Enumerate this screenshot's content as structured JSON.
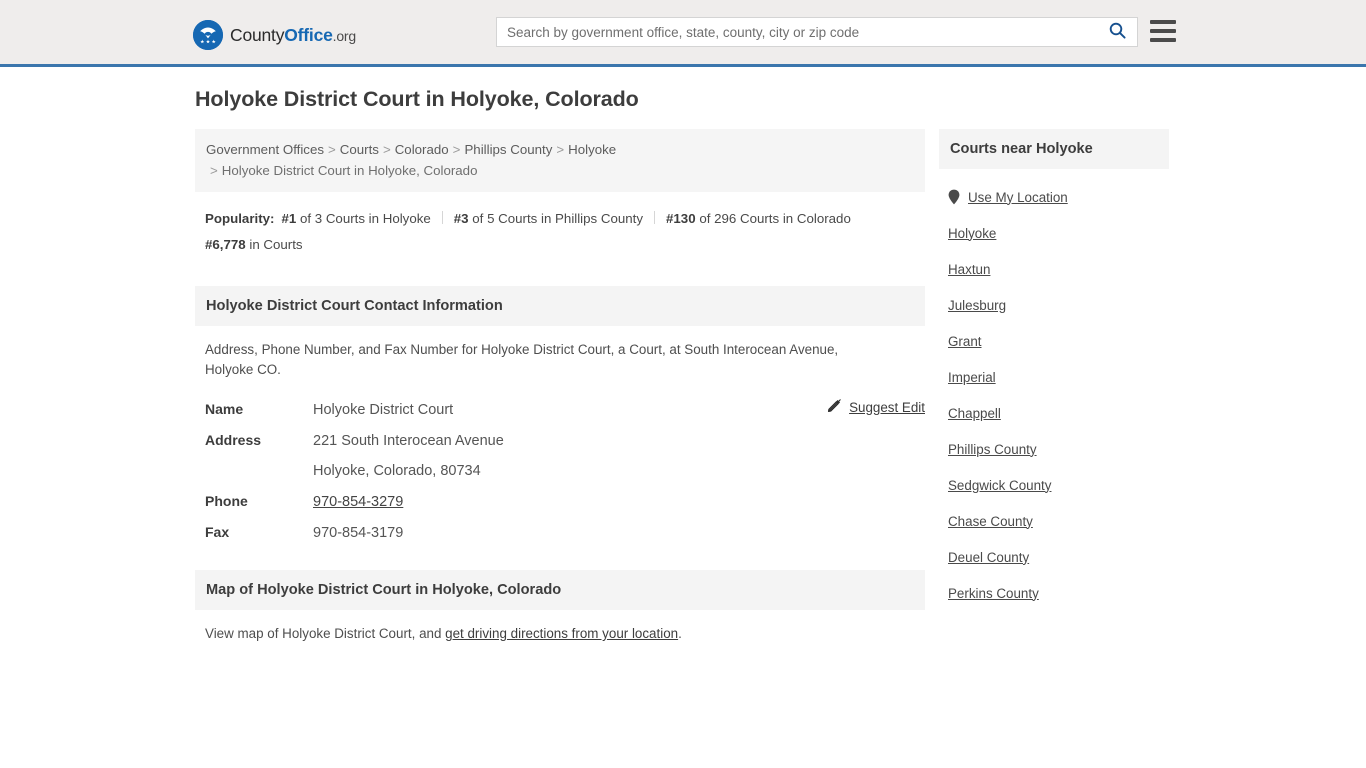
{
  "header": {
    "logo": {
      "part1": "County",
      "part2": "Office",
      "tld": ".org",
      "icon": "eagle-seal-icon"
    },
    "search": {
      "placeholder": "Search by government office, state, county, city or zip code",
      "value": "",
      "button_icon": "search-icon"
    },
    "menu_icon": "hamburger-menu-icon",
    "accent_color": "#3b76ad",
    "background_color": "#efedec"
  },
  "page_title": "Holyoke District Court in Holyoke, Colorado",
  "breadcrumb": {
    "separator": ">",
    "items": [
      "Government Offices",
      "Courts",
      "Colorado",
      "Phillips County",
      "Holyoke"
    ],
    "current": "Holyoke District Court in Holyoke, Colorado"
  },
  "popularity": {
    "label": "Popularity:",
    "entries": [
      {
        "rank": "#1",
        "text": "of 3 Courts in Holyoke"
      },
      {
        "rank": "#3",
        "text": "of 5 Courts in Phillips County"
      },
      {
        "rank": "#130",
        "text": "of 296 Courts in Colorado"
      },
      {
        "rank": "#6,778",
        "text": "in Courts"
      }
    ]
  },
  "contact_section": {
    "heading": "Holyoke District Court Contact Information",
    "description": "Address, Phone Number, and Fax Number for Holyoke District Court, a Court, at South Interocean Avenue, Holyoke CO.",
    "suggest_edit": {
      "label": "Suggest Edit",
      "icon": "edit-pencil-icon"
    },
    "rows": [
      {
        "key": "Name",
        "value": "Holyoke District Court",
        "link": false
      },
      {
        "key": "Address",
        "value": "221 South Interocean Avenue",
        "link": false
      },
      {
        "key": "",
        "value": "Holyoke, Colorado, 80734",
        "link": false
      },
      {
        "key": "Phone",
        "value": "970-854-3279",
        "link": true
      },
      {
        "key": "Fax",
        "value": "970-854-3179",
        "link": false
      }
    ]
  },
  "map_section": {
    "heading": "Map of Holyoke District Court in Holyoke, Colorado",
    "text_before": "View map of Holyoke District Court, and ",
    "link_text": "get driving directions from your location",
    "text_after": "."
  },
  "sidebar": {
    "heading": "Courts near Holyoke",
    "use_my_location": {
      "label": "Use My Location",
      "icon": "map-pin-icon"
    },
    "items": [
      "Holyoke",
      "Haxtun",
      "Julesburg",
      "Grant",
      "Imperial",
      "Chappell",
      "Phillips County",
      "Sedgwick County",
      "Chase County",
      "Deuel County",
      "Perkins County"
    ]
  }
}
